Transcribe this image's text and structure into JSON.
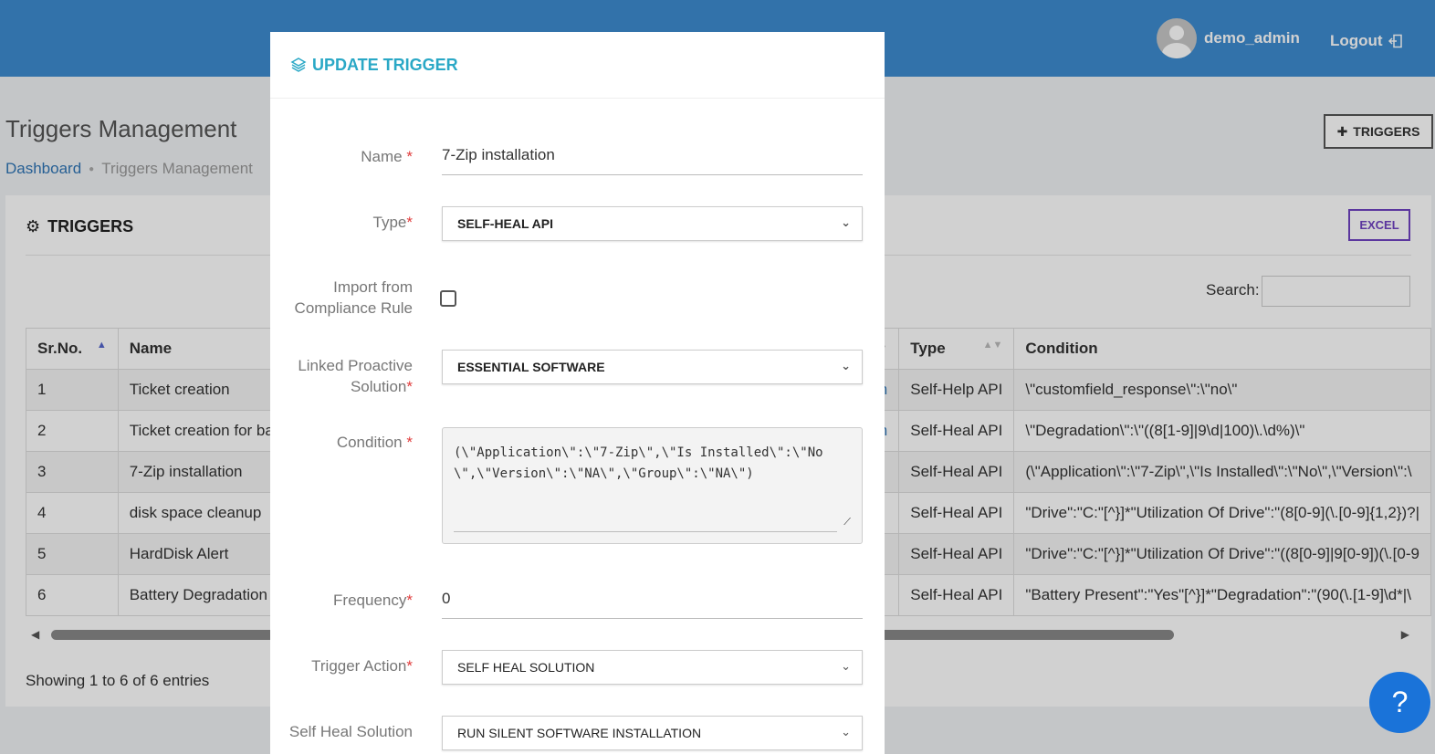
{
  "header": {
    "username": "demo_admin",
    "logout_label": "Logout"
  },
  "page": {
    "title": "Triggers Management",
    "breadcrumb": [
      "Dashboard",
      "Triggers Management"
    ],
    "add_button": "TRIGGERS"
  },
  "card": {
    "title": "TRIGGERS",
    "excel_label": "EXCEL",
    "search_label": "Search:",
    "search_value": "",
    "entries_text": "Showing 1 to 6 of 6 entries"
  },
  "table": {
    "columns": [
      "Sr.No.",
      "Name",
      "",
      "Type",
      "Condition"
    ],
    "rows": [
      {
        "no": "1",
        "name": "Ticket creation",
        "mid": "on",
        "type": "Self-Help API",
        "condition": "\\\"customfield_response\\\":\\\"no\\\""
      },
      {
        "no": "2",
        "name": "Ticket creation for ba",
        "mid": "on",
        "type": "Self-Heal API",
        "condition": "\\\"Degradation\\\":\\\"((8[1-9]|9\\d|100)\\.\\d%)\\\""
      },
      {
        "no": "3",
        "name": "7-Zip installation",
        "mid": "",
        "type": "Self-Heal API",
        "condition": "(\\\"Application\\\":\\\"7-Zip\\\",\\\"Is Installed\\\":\\\"No\\\",\\\"Version\\\":\\"
      },
      {
        "no": "4",
        "name": "disk space cleanup",
        "mid": "",
        "type": "Self-Heal API",
        "condition": "\"Drive\":\"C:\"[^}]*\"Utilization Of Drive\":\"(8[0-9](\\.[0-9]{1,2})?|"
      },
      {
        "no": "5",
        "name": "HardDisk Alert",
        "mid": "",
        "type": "Self-Heal API",
        "condition": "\"Drive\":\"C:\"[^}]*\"Utilization Of Drive\":\"((8[0-9]|9[0-9])(\\.[0-9"
      },
      {
        "no": "6",
        "name": "Battery Degradation A",
        "mid": "",
        "type": "Self-Heal API",
        "condition": "\"Battery Present\":\"Yes\"[^}]*\"Degradation\":\"(90(\\.[1-9]\\d*|\\"
      }
    ]
  },
  "modal": {
    "title": "UPDATE TRIGGER",
    "name_label": "Name",
    "name_value": "7-Zip installation",
    "type_label": "Type",
    "type_value": "SELF-HEAL API",
    "import_label": "Import from Compliance Rule",
    "import_checked": false,
    "linked_label": "Linked Proactive Solution",
    "linked_value": "ESSENTIAL SOFTWARE",
    "condition_label": "Condition",
    "condition_value": "(\\\"Application\\\":\\\"7-Zip\\\",\\\"Is Installed\\\":\\\"No\\\",\\\"Version\\\":\\\"NA\\\",\\\"Group\\\":\\\"NA\\\")",
    "frequency_label": "Frequency",
    "frequency_value": "0",
    "action_label": "Trigger Action",
    "action_value": "SELF HEAL SOLUTION",
    "heal_label": "Self Heal Solution",
    "heal_value": "RUN SILENT SOFTWARE INSTALLATION"
  },
  "help_label": "?",
  "colors": {
    "topbar": "#3d8bd0",
    "modal_title": "#2aa8c6",
    "excel_border": "#6f42c1",
    "required": "#e03b3b",
    "help_button": "#1a73d9"
  }
}
